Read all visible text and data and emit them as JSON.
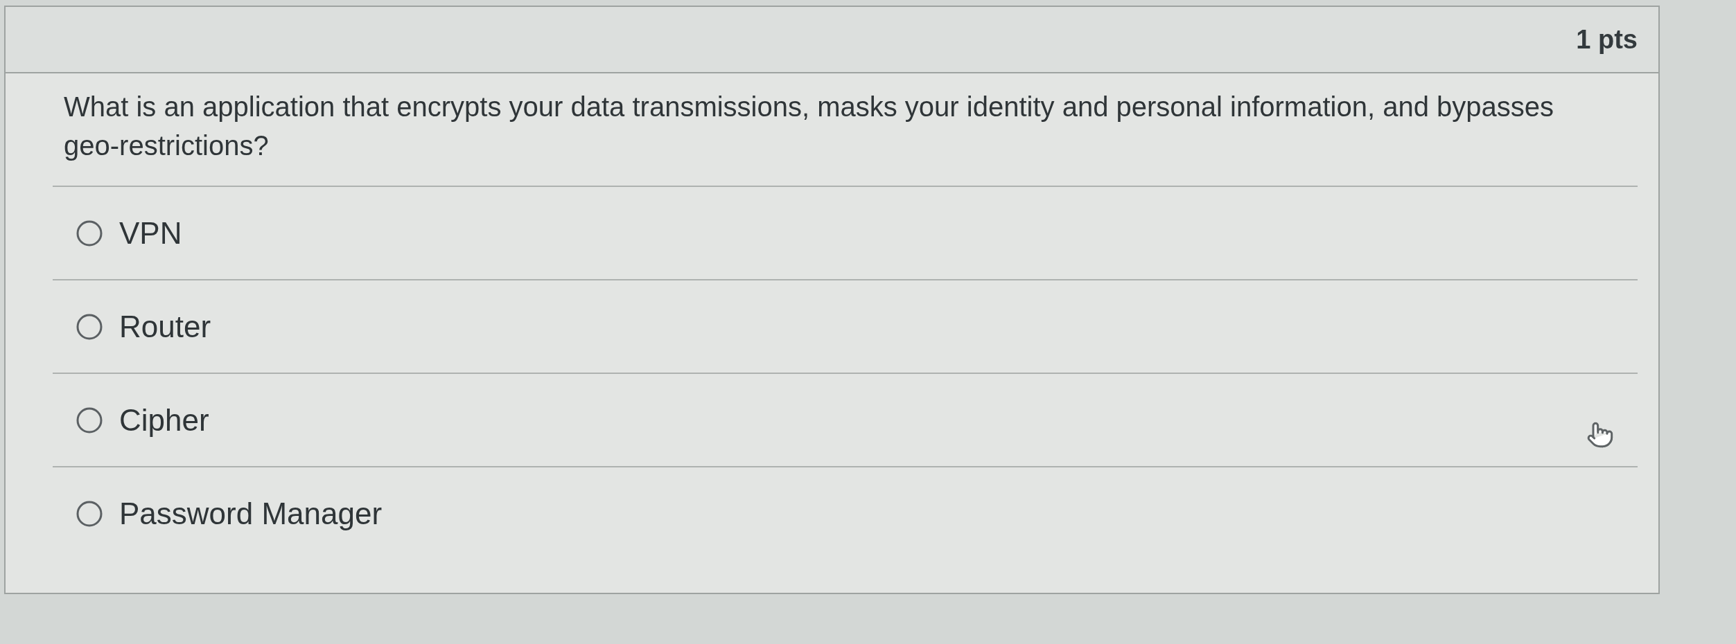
{
  "question": {
    "points": "1 pts",
    "text": "What is an application that encrypts your data transmissions, masks your identity and personal information, and bypasses geo-restrictions?"
  },
  "answers": [
    {
      "label": "VPN",
      "selected": false
    },
    {
      "label": "Router",
      "selected": false
    },
    {
      "label": "Cipher",
      "selected": false
    },
    {
      "label": "Password Manager",
      "selected": false
    }
  ]
}
